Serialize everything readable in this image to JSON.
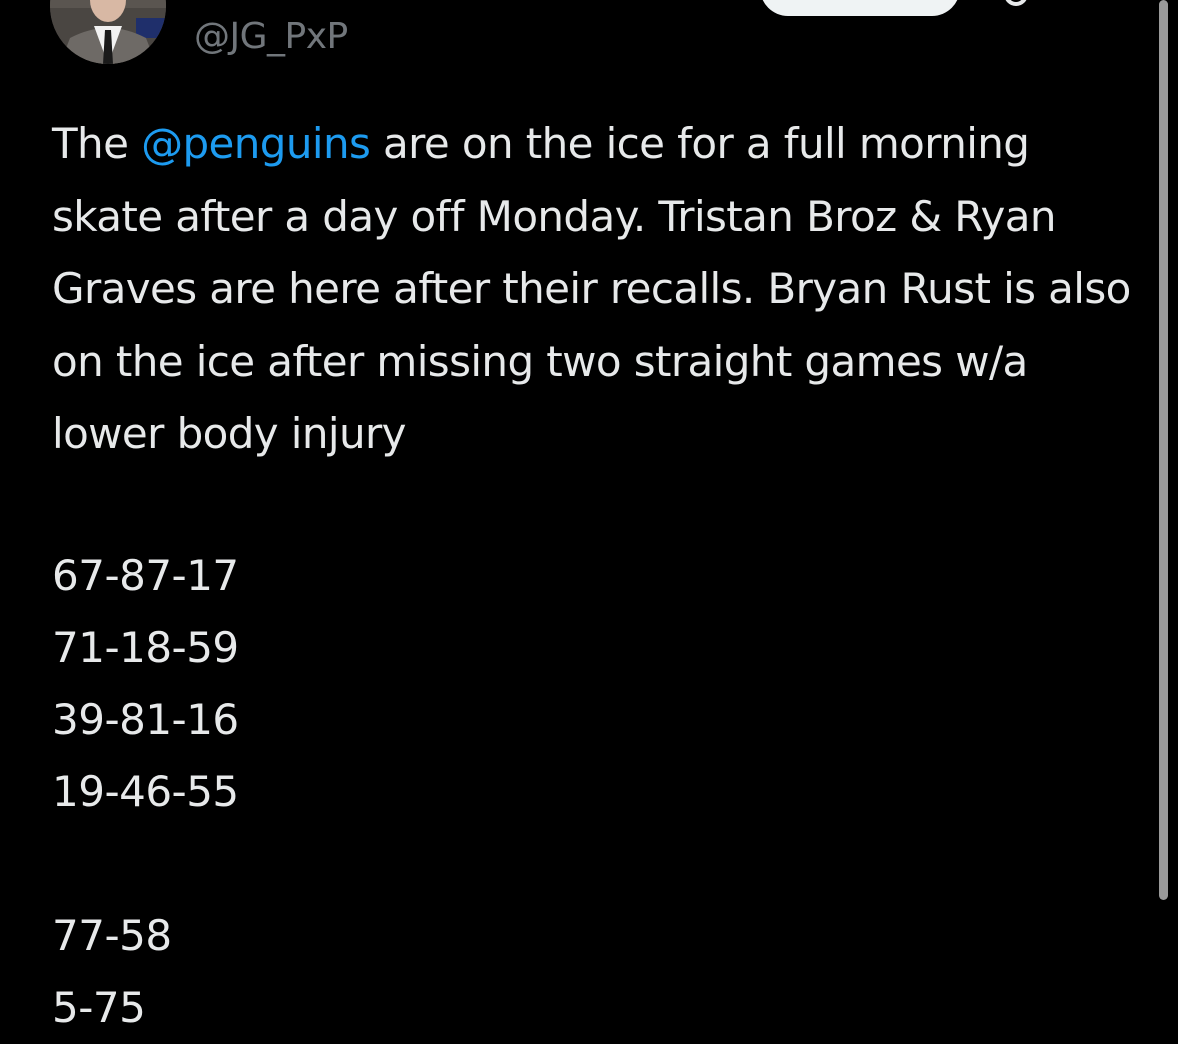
{
  "author": {
    "handle": "@JG_PxP",
    "avatar_icon": "profile-photo"
  },
  "tweet": {
    "text_before_mention": "The ",
    "mention": "@penguins",
    "text_after_mention": " are on the ice for a full morning skate after a day off Monday. Tristan Broz & Ryan Graves are here after their recalls. Bryan Rust is also on the ice after missing two straight games w/a lower body injury",
    "forward_lines": [
      "67-87-17",
      "71-18-59",
      "39-81-16",
      "19-46-55"
    ],
    "defense_pairs": [
      "77-58",
      "5-75"
    ]
  },
  "colors": {
    "background": "#000000",
    "text": "#e7e9ea",
    "secondary_text": "#71767b",
    "link": "#1d9bf0"
  },
  "icons": {
    "more": "more-icon"
  }
}
